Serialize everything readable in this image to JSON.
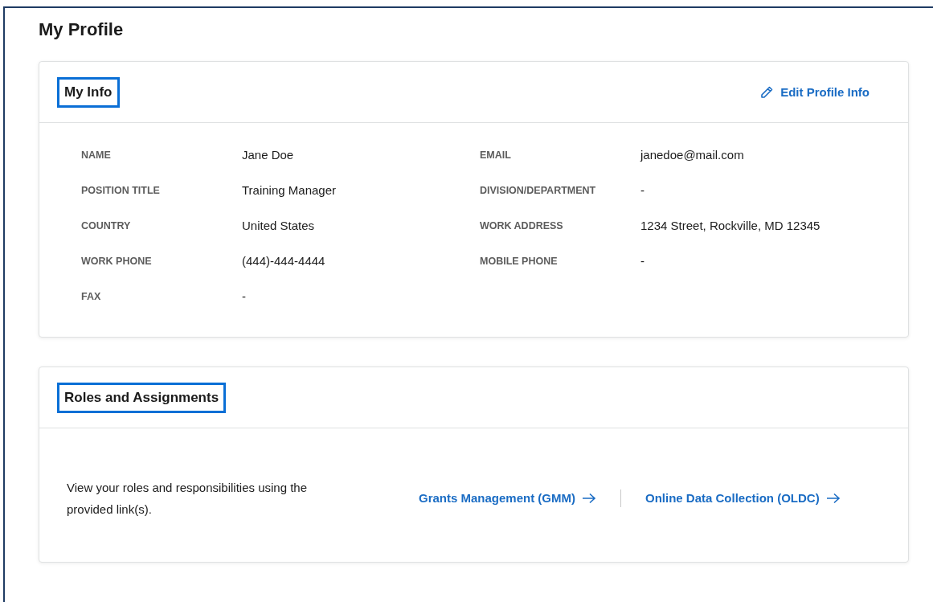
{
  "page_title": "My Profile",
  "my_info": {
    "title": "My Info",
    "highlighted": true,
    "edit_link": "Edit Profile Info",
    "fields": [
      {
        "label": "NAME",
        "value": "Jane Doe"
      },
      {
        "label": "EMAIL",
        "value": "janedoe@mail.com"
      },
      {
        "label": "POSITION TITLE",
        "value": "Training Manager"
      },
      {
        "label": "DIVISION/DEPARTMENT",
        "value": "-"
      },
      {
        "label": "COUNTRY",
        "value": "United States"
      },
      {
        "label": "WORK ADDRESS",
        "value": "1234 Street, Rockville, MD 12345"
      },
      {
        "label": "WORK PHONE",
        "value": "(444)-444-4444"
      },
      {
        "label": "MOBILE PHONE",
        "value": "-"
      },
      {
        "label": "FAX",
        "value": "-"
      }
    ]
  },
  "roles": {
    "title": "Roles and Assignments",
    "highlighted": true,
    "description": "View your roles and responsibilities using the provided link(s).",
    "links": [
      {
        "label": "Grants Management (GMM)"
      },
      {
        "label": "Online Data Collection (OLDC)"
      }
    ]
  }
}
